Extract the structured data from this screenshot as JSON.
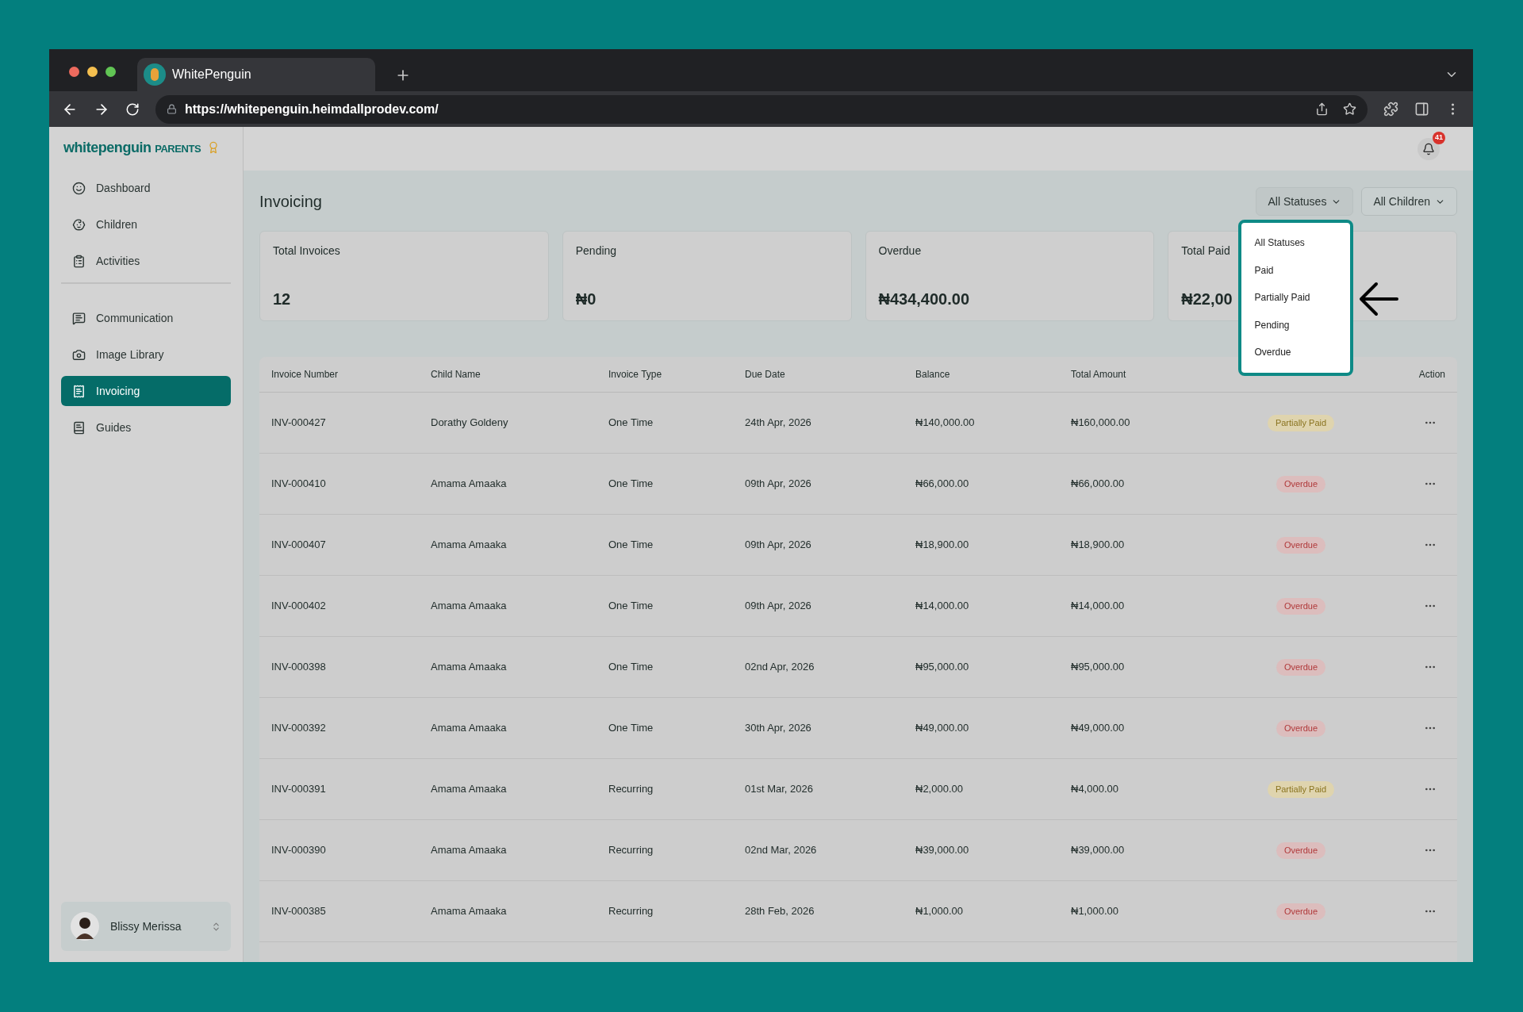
{
  "browser": {
    "tab_title": "WhitePenguin",
    "url": "https://whitepenguin.heimdallprodev.com/"
  },
  "sidebar": {
    "logo": {
      "brand": "whitepenguin",
      "suffix": "PARENTS"
    },
    "nav_groups": [
      [
        {
          "label": "Dashboard",
          "selected": false
        },
        {
          "label": "Children",
          "selected": false
        },
        {
          "label": "Activities",
          "selected": false
        }
      ],
      [
        {
          "label": "Communication",
          "selected": false
        },
        {
          "label": "Image Library",
          "selected": false
        },
        {
          "label": "Invoicing",
          "selected": true
        },
        {
          "label": "Guides",
          "selected": false
        }
      ]
    ],
    "user": {
      "name": "Blissy Merissa"
    }
  },
  "header": {
    "notification_count": "41"
  },
  "page": {
    "title": "Invoicing",
    "filters": [
      {
        "label": "All Statuses",
        "menu": [
          "All Statuses",
          "Paid",
          "Partially Paid",
          "Pending",
          "Overdue"
        ]
      },
      {
        "label": "All Children"
      }
    ],
    "cards": [
      {
        "label": "Total Invoices",
        "value": "12"
      },
      {
        "label": "Pending",
        "value": "₦0"
      },
      {
        "label": "Overdue",
        "value": "₦434,400.00"
      },
      {
        "label": "Total Paid",
        "value": "₦22,00"
      }
    ],
    "table": {
      "columns": [
        "Invoice Number",
        "Child Name",
        "Invoice Type",
        "Due Date",
        "Balance",
        "Total Amount"
      ],
      "action_column": "Action",
      "rows": [
        {
          "invoice": "INV-000427",
          "child": "Dorathy Goldeny",
          "type": "One Time",
          "due": "24th Apr, 2026",
          "balance": "₦140,000.00",
          "total": "₦160,000.00",
          "status": {
            "label": "Partially Paid",
            "kind": "partial"
          }
        },
        {
          "invoice": "INV-000410",
          "child": "Amama Amaaka",
          "type": "One Time",
          "due": "09th Apr, 2026",
          "balance": "₦66,000.00",
          "total": "₦66,000.00",
          "status": {
            "label": "Overdue",
            "kind": "overdue"
          }
        },
        {
          "invoice": "INV-000407",
          "child": "Amama Amaaka",
          "type": "One Time",
          "due": "09th Apr, 2026",
          "balance": "₦18,900.00",
          "total": "₦18,900.00",
          "status": {
            "label": "Overdue",
            "kind": "overdue"
          }
        },
        {
          "invoice": "INV-000402",
          "child": "Amama Amaaka",
          "type": "One Time",
          "due": "09th Apr, 2026",
          "balance": "₦14,000.00",
          "total": "₦14,000.00",
          "status": {
            "label": "Overdue",
            "kind": "overdue"
          }
        },
        {
          "invoice": "INV-000398",
          "child": "Amama Amaaka",
          "type": "One Time",
          "due": "02nd Apr, 2026",
          "balance": "₦95,000.00",
          "total": "₦95,000.00",
          "status": {
            "label": "Overdue",
            "kind": "overdue"
          }
        },
        {
          "invoice": "INV-000392",
          "child": "Amama Amaaka",
          "type": "One Time",
          "due": "30th Apr, 2026",
          "balance": "₦49,000.00",
          "total": "₦49,000.00",
          "status": {
            "label": "Overdue",
            "kind": "overdue"
          }
        },
        {
          "invoice": "INV-000391",
          "child": "Amama Amaaka",
          "type": "Recurring",
          "due": "01st Mar, 2026",
          "balance": "₦2,000.00",
          "total": "₦4,000.00",
          "status": {
            "label": "Partially Paid",
            "kind": "partial"
          }
        },
        {
          "invoice": "INV-000390",
          "child": "Amama Amaaka",
          "type": "Recurring",
          "due": "02nd Mar, 2026",
          "balance": "₦39,000.00",
          "total": "₦39,000.00",
          "status": {
            "label": "Overdue",
            "kind": "overdue"
          }
        },
        {
          "invoice": "INV-000385",
          "child": "Amama Amaaka",
          "type": "Recurring",
          "due": "28th Feb, 2026",
          "balance": "₦1,000.00",
          "total": "₦1,000.00",
          "status": {
            "label": "Overdue",
            "kind": "overdue"
          }
        }
      ]
    }
  }
}
